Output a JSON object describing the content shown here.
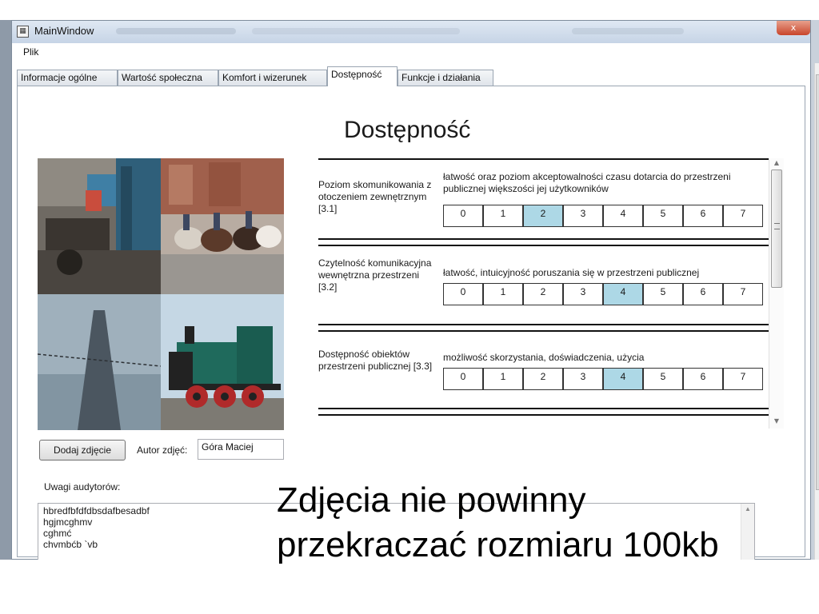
{
  "window": {
    "title": "MainWindow",
    "close_glyph": "x"
  },
  "menu": {
    "file": "Plik"
  },
  "tabs": [
    {
      "label": "Informacje ogólne"
    },
    {
      "label": "Wartość społeczna"
    },
    {
      "label": "Komfort i wizerunek"
    },
    {
      "label": "Dostępność",
      "active": true
    },
    {
      "label": "Funkcje i działania"
    }
  ],
  "page": {
    "heading": "Dostępność"
  },
  "criteria": [
    {
      "label": "Poziom skomunikowania z otoczeniem zewnętrznym [3.1]",
      "description": "łatwość oraz poziom akceptowalności czasu dotarcia do przestrzeni publicznej większości jej użytkowników",
      "scale": [
        "0",
        "1",
        "2",
        "3",
        "4",
        "5",
        "6",
        "7"
      ],
      "selected": "2"
    },
    {
      "label": "Czytelność komunikacyjna wewnętrzna przestrzeni [3.2]",
      "description": "łatwość, intuicyjność poruszania się w przestrzeni publicznej",
      "scale": [
        "0",
        "1",
        "2",
        "3",
        "4",
        "5",
        "6",
        "7"
      ],
      "selected": "4"
    },
    {
      "label": "Dostępność obiektów przestrzeni publicznej [3.3]",
      "description": "możliwość skorzystania, doświadczenia, użycia",
      "scale": [
        "0",
        "1",
        "2",
        "3",
        "4",
        "5",
        "6",
        "7"
      ],
      "selected": "4"
    }
  ],
  "photos": {
    "add_button": "Dodaj zdjęcie",
    "author_label": "Autor zdjęć:",
    "author_value": "Góra Maciej"
  },
  "notes": {
    "label": "Uwagi audytorów:",
    "lines": [
      "hbredfbfdfdbsdafbesadbf",
      "hgjmcghmv",
      "cghmć",
      "chvmbćb `vb"
    ]
  },
  "caption": {
    "line1": "Zdjęcia nie powinny",
    "line2": "przekraczać rozmiaru 100kb"
  },
  "colors": {
    "selected_cell": "#add8e6",
    "titlebar": "#c6d4e6",
    "close": "#c8452b"
  },
  "icons": {
    "app": "app-icon",
    "close": "close-icon",
    "scroll_up": "scroll-up-icon",
    "scroll_down": "scroll-down-icon"
  }
}
